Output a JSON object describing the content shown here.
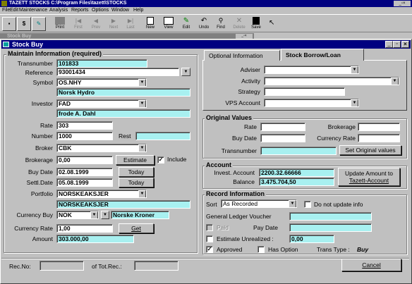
{
  "app": {
    "title": "TAZETT STOCKS  C:\\Program Files\\tazett\\STOCKS",
    "menu": [
      "File",
      "Edit",
      "Maintenance",
      "Analysis",
      "Reports",
      "Options",
      "Window",
      "Help"
    ]
  },
  "toolbar": {
    "buttons": [
      "Print",
      "First",
      "Prev",
      "Next",
      "Last",
      "New",
      "View",
      "Edit",
      "Undo",
      "Find",
      "Delete",
      "Save"
    ]
  },
  "bg_window": {
    "title": "Stock Buy"
  },
  "dialog": {
    "title": "Stock Buy"
  },
  "maintain": {
    "title": "Maintain Information (required)",
    "transnumber_label": "Transnumber",
    "transnumber": "101833",
    "reference_label": "Reference",
    "reference": "93001434",
    "symbol_label": "Symbol",
    "symbol": "OS.NHY",
    "symbol_name": "Norsk Hydro",
    "investor_label": "Investor",
    "investor": "FAD",
    "investor_name": "frode A. Dahl",
    "rate_label": "Rate",
    "rate": "303",
    "number_label": "Number",
    "number": "1000",
    "rest_label": "Rest",
    "rest": "",
    "broker_label": "Broker",
    "broker": "CBK",
    "brokerage_label": "Brokerage",
    "brokerage": "0,00",
    "estimate_button": "Estimate",
    "include_label": "Include",
    "buy_date_label": "Buy Date",
    "buy_date": "02.08.1999",
    "settl_date_label": "Settl.Date",
    "settl_date": "05.08.1999",
    "today_button": "Today",
    "portfolio_label": "Portfolio",
    "portfolio": "NORSKEAKSJER",
    "portfolio_name": "NORSKEAKSJER",
    "currency_buy_label": "Currency Buy",
    "currency_buy": "NOK",
    "currency_name": "Norske Kroner",
    "currency_rate_label": "Currency Rate",
    "currency_rate": "1,00",
    "get_button": "Get",
    "amount_label": "Amount",
    "amount": "303.000,00"
  },
  "tabs": {
    "optional": "Optional Information",
    "borrow": "Stock Borrow/Loan"
  },
  "optional": {
    "adviser_label": "Adviser",
    "adviser": "",
    "activity_label": "Activity",
    "activity": "",
    "strategy_label": "Strategy",
    "strategy": "",
    "vps_label": "VPS Account",
    "vps": ""
  },
  "original": {
    "title": "Original Values",
    "rate_label": "Rate",
    "rate": "",
    "brokerage_label": "Brokerage",
    "brokerage": "",
    "buy_date_label": "Buy Date",
    "buy_date": "",
    "currency_rate_label": "Currency Rate",
    "currency_rate": "",
    "transnumber_label": "Transnumber",
    "transnumber": "",
    "set_button": "Set Original values"
  },
  "account": {
    "title": "Account",
    "invest_label": "Invest. Account",
    "invest": "2200.32.66666",
    "balance_label": "Balance",
    "balance": "3.475.704,50",
    "update_button_line1": "Update Amount to",
    "update_button_line2": "Tazett-Account"
  },
  "record": {
    "title": "Record Information",
    "sort_label": "Sort",
    "sort": "As Recorded",
    "no_update_label": "Do not update info",
    "gl_label": "General Ledger Voucher",
    "gl": "",
    "paid_label": "Paid",
    "pay_date_label": "Pay Date",
    "pay_date": "",
    "estimate_unrealized_label": "Estimate Unrealized :",
    "estimate_unrealized": "0,00",
    "approved_label": "Approved",
    "has_option_label": "Has Option",
    "trans_type_label": "Trans Type :",
    "trans_type": "Buy"
  },
  "footer": {
    "rec_no_label": "Rec.No:",
    "rec_no": "",
    "of_tot_label": "of Tot.Rec.:",
    "tot_rec": "",
    "cancel_button": "Cancel"
  },
  "colors": {
    "title_bar": "#000080",
    "readonly_field": "#a8f0f0",
    "face": "#c0c0c0"
  }
}
